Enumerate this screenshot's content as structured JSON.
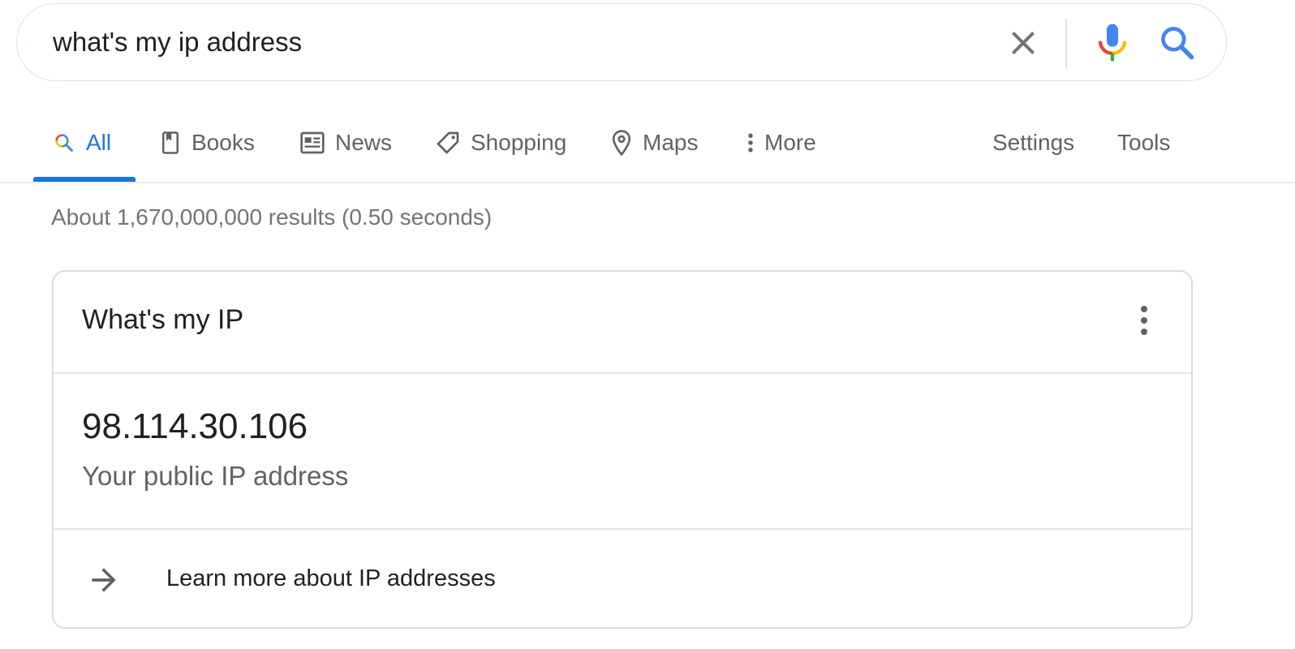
{
  "search": {
    "query": "what's my ip address",
    "clear_icon": "close-icon",
    "mic_icon": "mic-icon",
    "search_icon": "search-icon"
  },
  "tabs": {
    "items": [
      {
        "label": "All",
        "icon": "search-icon",
        "active": true
      },
      {
        "label": "Books",
        "icon": "book-icon"
      },
      {
        "label": "News",
        "icon": "newspaper-icon"
      },
      {
        "label": "Shopping",
        "icon": "tag-icon"
      },
      {
        "label": "Maps",
        "icon": "map-pin-icon"
      },
      {
        "label": "More",
        "icon": "vertical-dots-icon"
      }
    ],
    "settings_label": "Settings",
    "tools_label": "Tools"
  },
  "results": {
    "stats": "About 1,670,000,000 results (0.50 seconds)"
  },
  "card": {
    "title": "What's my IP",
    "ip": "98.114.30.106",
    "caption": "Your public IP address",
    "learn_more": "Learn more about IP addresses",
    "menu_icon": "more-vert-icon",
    "arrow_icon": "arrow-right-icon"
  },
  "colors": {
    "accent": "#1a73e8",
    "text": "#202124",
    "secondary": "#5f6368",
    "border": "#dadce0"
  }
}
